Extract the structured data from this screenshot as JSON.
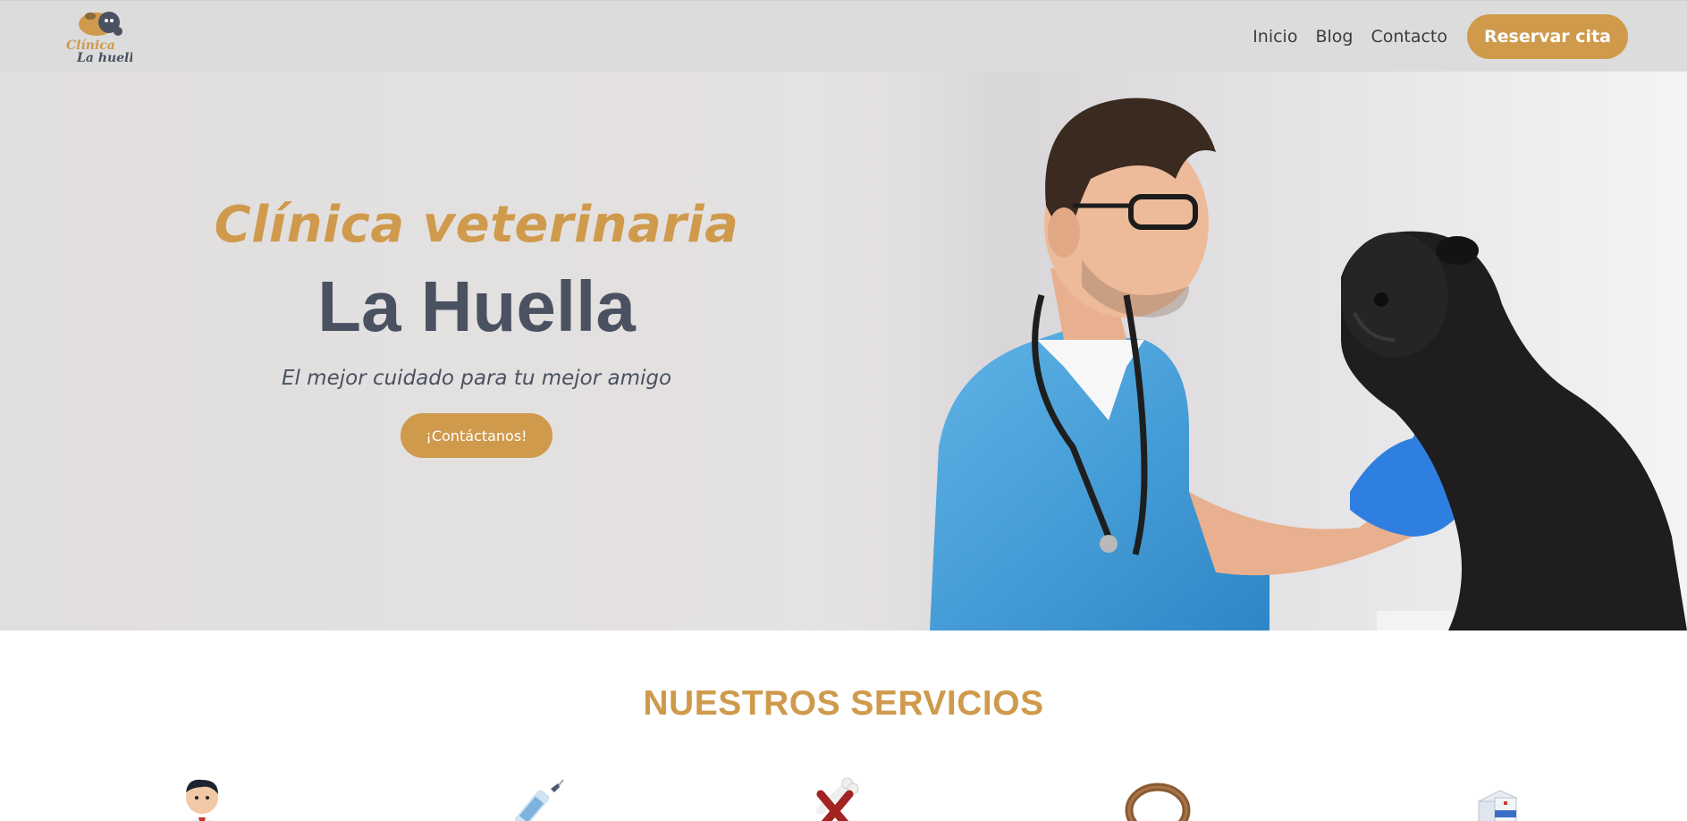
{
  "brand": {
    "logo_line1": "Clínica",
    "logo_line2": "La huella"
  },
  "nav": {
    "links": [
      {
        "label": "Inicio"
      },
      {
        "label": "Blog"
      },
      {
        "label": "Contacto"
      }
    ],
    "cta_label": "Reservar cita"
  },
  "hero": {
    "kicker": "Clínica veterinaria",
    "title": "La Huella",
    "subtitle": "El mejor cuidado para tu mejor amigo",
    "button_label": "¡Contáctanos!"
  },
  "services": {
    "title": "NUESTROS SERVICIOS",
    "icons": [
      {
        "icon": "veterinarian-doctor-icon"
      },
      {
        "icon": "syringe-vaccine-icon"
      },
      {
        "icon": "bone-food-icon"
      },
      {
        "icon": "leash-collar-icon"
      },
      {
        "icon": "pharmacy-medicine-icon"
      }
    ]
  },
  "colors": {
    "accent": "#cf9a4c",
    "navbar_bg": "#dcdcdc",
    "hero_bg": "#e3e0e0",
    "title_text": "#4a5160"
  }
}
